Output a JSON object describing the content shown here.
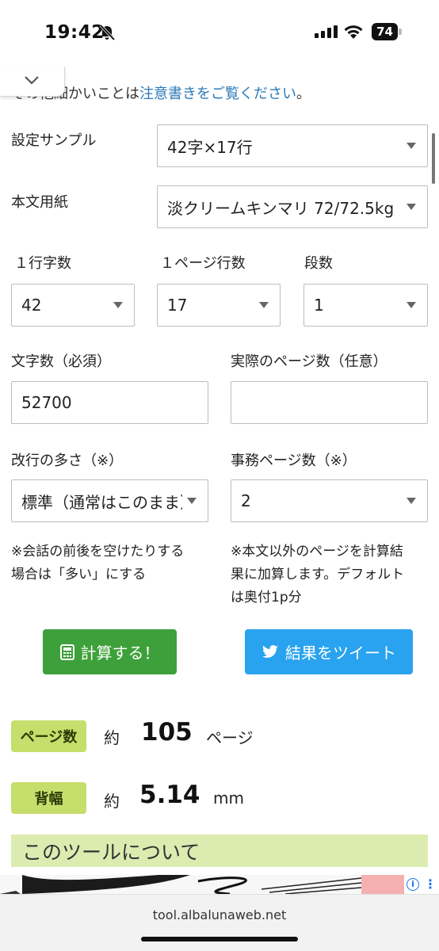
{
  "status_bar": {
    "time": "19:42",
    "battery": "74",
    "icons": [
      "bell-slash-icon",
      "cellular-signal-icon",
      "wifi-icon",
      "battery-icon"
    ]
  },
  "top_note": {
    "prefix": "その他細かいことは",
    "link": "注意書きをご覧ください",
    "suffix": "。"
  },
  "form": {
    "sample": {
      "label": "設定サンプル",
      "value": "42字×17行"
    },
    "paper": {
      "label": "本文用紙",
      "value": "淡クリームキンマリ 72/72.5kg"
    },
    "chars_per_line": {
      "label": "１行字数",
      "value": "42"
    },
    "lines_per_page": {
      "label": "１ページ行数",
      "value": "17"
    },
    "columns": {
      "label": "段数",
      "value": "1"
    },
    "char_count": {
      "label": "文字数（必須）",
      "value": "52700"
    },
    "actual_pages": {
      "label": "実際のページ数（任意）",
      "value": ""
    },
    "line_breaks": {
      "label": "改行の多さ（※）",
      "value": "標準（通常はこのまま）"
    },
    "office_pages": {
      "label": "事務ページ数（※）",
      "value": "2"
    },
    "note_left": [
      "※会話の前後を空けたりする",
      "場合は「多い」にする"
    ],
    "note_right": [
      "※本文以外のページを計算結",
      "果に加算します。デフォルト",
      "は奥付1p分"
    ]
  },
  "buttons": {
    "calculate": "計算する！",
    "tweet": "結果をツイート"
  },
  "results": {
    "pages": {
      "badge": "ページ数",
      "prefix": "約",
      "value": "105",
      "unit": "ページ"
    },
    "spine": {
      "badge": "背幅",
      "prefix": "約",
      "value": "5.14",
      "unit": "mm"
    }
  },
  "section": {
    "title": "このツールについて"
  },
  "browser": {
    "url": "tool.albalunaweb.net"
  },
  "colors": {
    "link": "#2a7ab8",
    "calculate_button": "#3ea03a",
    "tweet_button": "#29a3ef",
    "badge": "#c6de6b",
    "section_heading": "#dcebb0"
  }
}
